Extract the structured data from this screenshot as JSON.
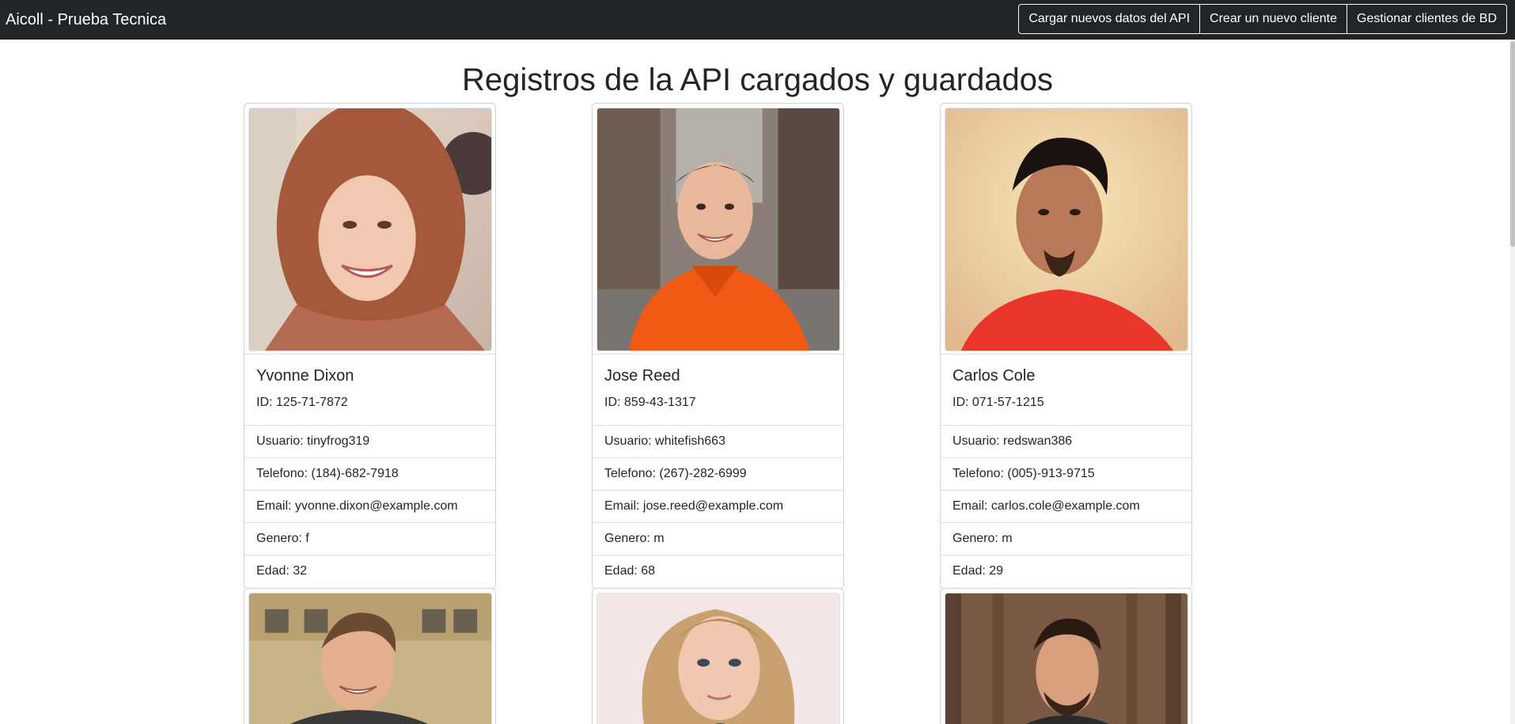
{
  "navbar": {
    "brand": "Aicoll - Prueba Tecnica",
    "buttons": [
      "Cargar nuevos datos del API",
      "Crear un nuevo cliente",
      "Gestionar clientes de BD"
    ]
  },
  "main": {
    "title": "Registros de la API cargados y guardados"
  },
  "cards": [
    {
      "name": "Yvonne Dixon",
      "id": "ID: 125-71-7872",
      "usuario": "Usuario: tinyfrog319",
      "telefono": "Telefono: (184)-682-7918",
      "email": "Email: yvonne.dixon@example.com",
      "genero": "Genero: f",
      "edad": "Edad: 32"
    },
    {
      "name": "Jose Reed",
      "id": "ID: 859-43-1317",
      "usuario": "Usuario: whitefish663",
      "telefono": "Telefono: (267)-282-6999",
      "email": "Email: jose.reed@example.com",
      "genero": "Genero: m",
      "edad": "Edad: 68"
    },
    {
      "name": "Carlos Cole",
      "id": "ID: 071-57-1215",
      "usuario": "Usuario: redswan386",
      "telefono": "Telefono: (005)-913-9715",
      "email": "Email: carlos.cole@example.com",
      "genero": "Genero: m",
      "edad": "Edad: 29"
    }
  ],
  "colors": {
    "navbar_bg": "#212529",
    "text": "#212529",
    "border": "#dee2e6"
  }
}
